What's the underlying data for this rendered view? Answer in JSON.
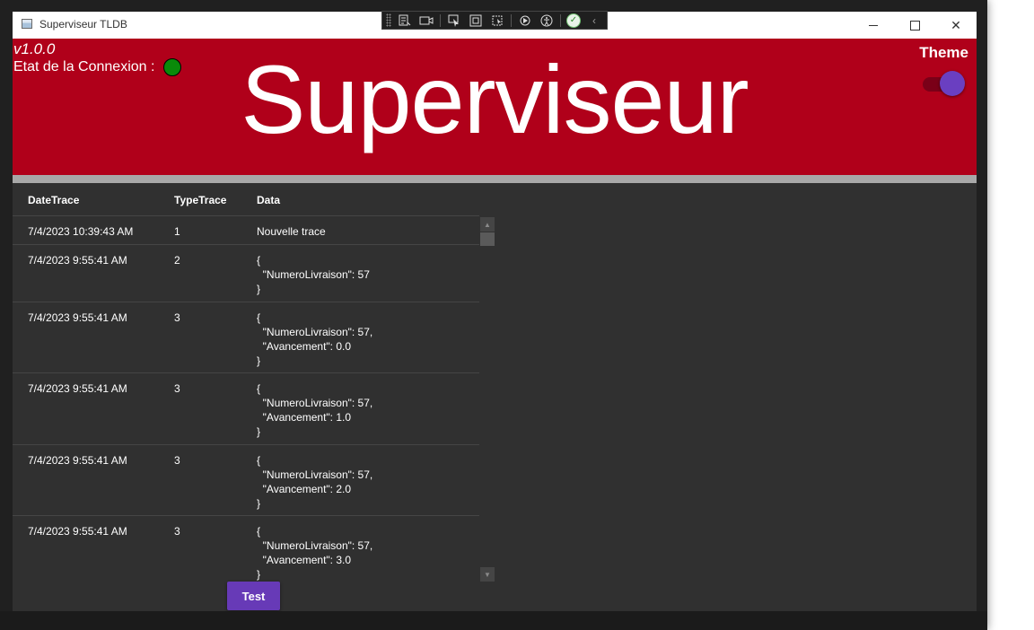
{
  "window": {
    "title": "Superviseur TLDB",
    "minimize_icon": "minimize-icon",
    "maximize_icon": "maximize-icon",
    "close_glyph": "✕"
  },
  "header": {
    "version": "v1.0.0",
    "connection_label": "Etat de la Connexion :",
    "connection_status_color": "#0a8a0a",
    "title": "Superviseur",
    "theme_label": "Theme",
    "background_color": "#b0001a"
  },
  "table": {
    "columns": [
      "DateTrace",
      "TypeTrace",
      "Data"
    ],
    "rows": [
      {
        "date": "7/4/2023 10:39:43 AM",
        "type": "1",
        "data": "Nouvelle trace"
      },
      {
        "date": "7/4/2023 9:55:41 AM",
        "type": "2",
        "data": "{\n  \"NumeroLivraison\": 57\n}"
      },
      {
        "date": "7/4/2023 9:55:41 AM",
        "type": "3",
        "data": "{\n  \"NumeroLivraison\": 57,\n  \"Avancement\": 0.0\n}"
      },
      {
        "date": "7/4/2023 9:55:41 AM",
        "type": "3",
        "data": "{\n  \"NumeroLivraison\": 57,\n  \"Avancement\": 1.0\n}"
      },
      {
        "date": "7/4/2023 9:55:41 AM",
        "type": "3",
        "data": "{\n  \"NumeroLivraison\": 57,\n  \"Avancement\": 2.0\n}"
      },
      {
        "date": "7/4/2023 9:55:41 AM",
        "type": "3",
        "data": "{\n  \"NumeroLivraison\": 57,\n  \"Avancement\": 3.0\n}"
      }
    ]
  },
  "actions": {
    "test_label": "Test",
    "accent_color": "#673ab7"
  }
}
